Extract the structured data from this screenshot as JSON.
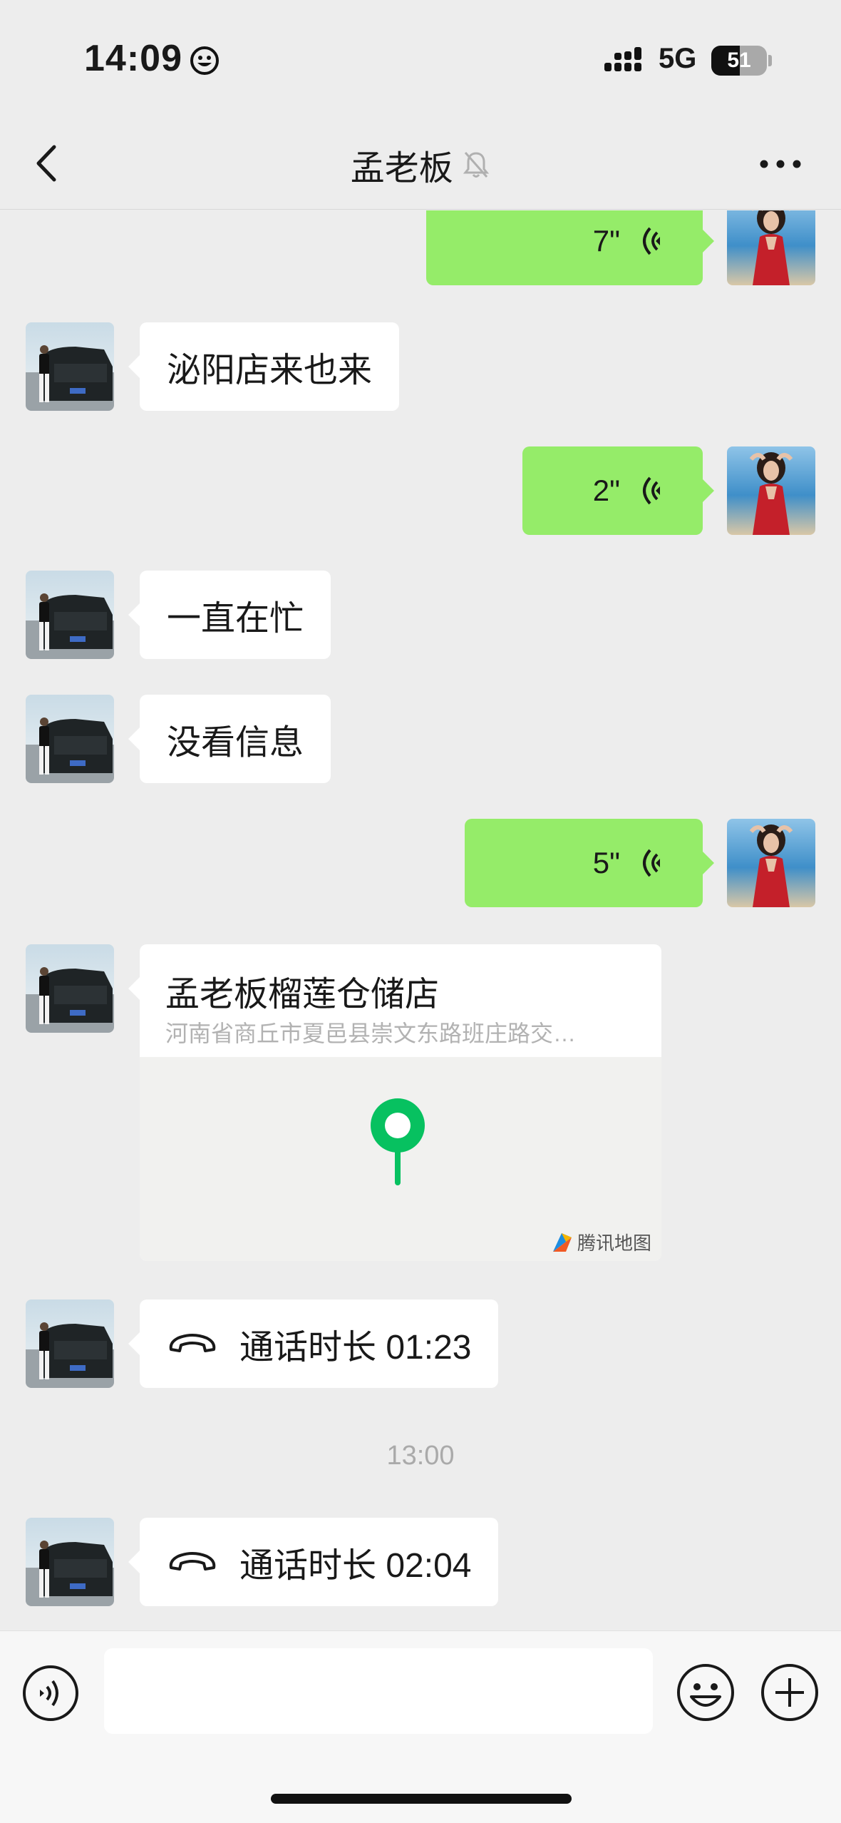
{
  "status_bar": {
    "time": "14:09",
    "network": "5G",
    "battery": "51",
    "battery_level": 0.51,
    "icons": [
      "smiley-icon",
      "signal-icon",
      "battery-icon"
    ]
  },
  "nav": {
    "title": "孟老板",
    "icons": [
      "back-chevron-icon",
      "mute-bell-icon",
      "more-dots-icon"
    ]
  },
  "messages": [
    {
      "side": "out",
      "type": "voice",
      "duration": "7\""
    },
    {
      "side": "in",
      "type": "text",
      "text": "泌阳店来也来"
    },
    {
      "side": "out",
      "type": "voice",
      "duration": "2\""
    },
    {
      "side": "in",
      "type": "text",
      "text": "一直在忙"
    },
    {
      "side": "in",
      "type": "text",
      "text": "没看信息"
    },
    {
      "side": "out",
      "type": "voice",
      "duration": "5\""
    },
    {
      "side": "in",
      "type": "location",
      "name": "孟老板榴莲仓储店",
      "address": "河南省商丘市夏邑县崇文东路班庄路交…",
      "map_provider": "腾讯地图"
    },
    {
      "side": "in",
      "type": "call",
      "text": "通话时长 01:23"
    },
    {
      "side": "divider",
      "type": "time",
      "text": "13:00"
    },
    {
      "side": "in",
      "type": "call",
      "text": "通话时长 02:04"
    }
  ],
  "input_bar": {
    "message_value": "",
    "icons": [
      "voice-mode-icon",
      "emoji-icon",
      "plus-icon"
    ]
  },
  "colors": {
    "background": "#ededed",
    "outgoing_bubble": "#95ec69",
    "incoming_bubble": "#ffffff",
    "map_pin": "#07c160"
  }
}
